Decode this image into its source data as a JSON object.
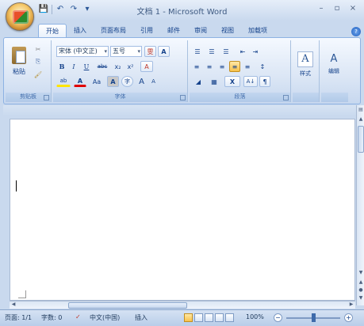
{
  "window": {
    "title": "文档 1 - Microsoft Word",
    "qat": {
      "save": "💾",
      "undo": "↶",
      "redo": "↷",
      "more": "▾"
    },
    "controls": {
      "minimize": "–",
      "maximize": "▫",
      "close": "×"
    }
  },
  "tabs": [
    "开始",
    "插入",
    "页面布局",
    "引用",
    "邮件",
    "审阅",
    "视图",
    "加载项"
  ],
  "active_tab": "开始",
  "help_icon": "?",
  "ribbon": {
    "clipboard": {
      "label": "剪贴板",
      "paste_label": "粘贴",
      "cut_icon": "✂",
      "copy_icon": "⎘",
      "format_painter_icon": "🖌"
    },
    "font": {
      "label": "字体",
      "font_name": "宋体 (中文正)",
      "font_size": "五号",
      "phonetic": "雯",
      "border_char": "A",
      "bold": "B",
      "italic": "I",
      "underline": "U",
      "strike": "abc",
      "subscript": "x₂",
      "superscript": "x²",
      "clear": "A",
      "highlight": "ab",
      "font_color": "A",
      "change_case": "Aa",
      "char_shading": "A",
      "enclose": "字",
      "grow": "A",
      "shrink": "A"
    },
    "paragraph": {
      "label": "段落",
      "bullets": "☰",
      "numbering": "☰",
      "multilevel": "☰",
      "decrease_indent": "⇤",
      "increase_indent": "⇥",
      "align_left": "≡",
      "center": "≡",
      "align_right": "≡",
      "justify": "≡",
      "distributed": "≡",
      "line_spacing": "↕",
      "shading": "◢",
      "borders": "▦",
      "sort_chinese": "X",
      "sort": "A↓",
      "show_marks": "¶"
    },
    "styles": {
      "label": "样式",
      "icon": "A"
    },
    "editing": {
      "label": "编辑",
      "icon": "A"
    }
  },
  "status": {
    "page": "页面: 1/1",
    "words": "字数: 0",
    "language": "中文(中国)",
    "mode": "插入",
    "zoom": "100%",
    "zoom_out": "−",
    "zoom_in": "+"
  }
}
